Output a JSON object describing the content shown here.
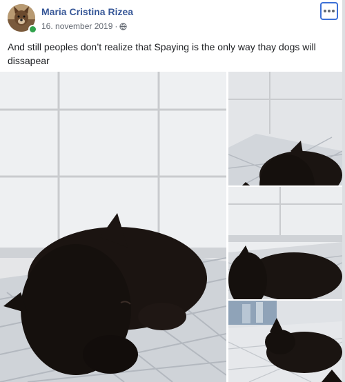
{
  "post": {
    "author": "Maria Cristina Rizea",
    "date": "16. november 2019",
    "separator": "·",
    "privacy_icon": "globe-icon",
    "menu_icon": "more-options-icon",
    "text": "And still peoples don’t realize that Spaying is the only way thay dogs will dissapear",
    "online": true
  },
  "photos": [
    {
      "name": "black puppy sleeping on white quilted pad, close-up"
    },
    {
      "name": "black puppy sleeping, top view"
    },
    {
      "name": "black puppy lying on pad, side view"
    },
    {
      "name": "black puppy sleeping on pad near bottles"
    }
  ],
  "colors": {
    "author": "#385898",
    "meta": "#616770",
    "text": "#1c1e21",
    "focus_ring": "#3b6fd6",
    "online": "#31a24c"
  }
}
